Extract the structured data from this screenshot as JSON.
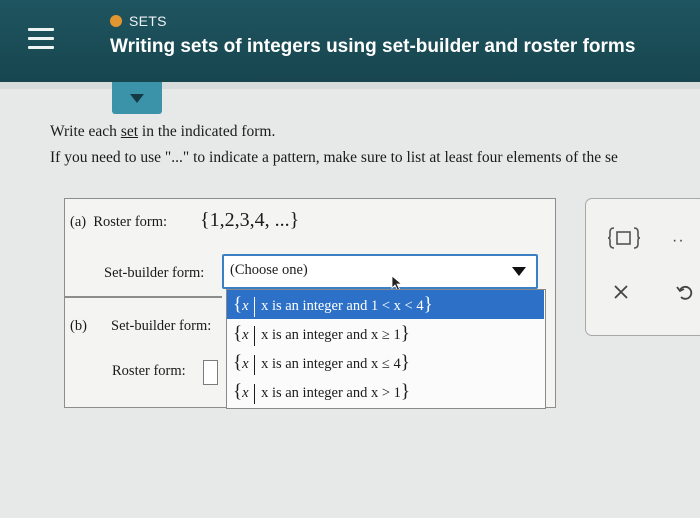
{
  "header": {
    "topic_label": "SETS",
    "title": "Writing sets of integers using set-builder and roster forms"
  },
  "instructions": {
    "line1_prefix": "Write each ",
    "line1_link": "set",
    "line1_suffix": " in the indicated form.",
    "line2": "If you need to use \"...\" to indicate a pattern, make sure to list at least four elements of the se"
  },
  "part_a": {
    "letter": "(a)",
    "roster_label": "Roster form:",
    "roster_value": "{1,2,3,4, ...}",
    "setbuilder_label": "Set-builder form:",
    "dropdown_selected": "(Choose one)"
  },
  "part_b": {
    "letter": "(b)",
    "setbuilder_label": "Set-builder form:",
    "roster_label": "Roster form:"
  },
  "dropdown_options": [
    {
      "open": "{",
      "var": "x",
      "cond": "x is an integer and 1 < x < 4",
      "close": "}"
    },
    {
      "open": "{",
      "var": "x",
      "cond": "x is an integer and x ≥ 1",
      "close": "}"
    },
    {
      "open": "{",
      "var": "x",
      "cond": "x is an integer and x ≤ 4",
      "close": "}"
    },
    {
      "open": "{",
      "var": "x",
      "cond": "x is an integer and x > 1",
      "close": "}"
    }
  ],
  "toolbar": {
    "more_label": "··"
  },
  "icons": {
    "menu": "hamburger-icon",
    "topic_dot": "orange-dot-icon",
    "collapse": "triangle-down-icon",
    "template": "set-braces-template-icon",
    "close": "close-icon",
    "undo": "undo-icon",
    "cursor": "mouse-pointer-icon"
  },
  "colors": {
    "header_bg": "#1f5560",
    "topic_dot": "#e2962f",
    "collapse_tab": "#3b93a9",
    "dropdown_border": "#3b7fc4",
    "option_highlight": "#2c70c7"
  }
}
